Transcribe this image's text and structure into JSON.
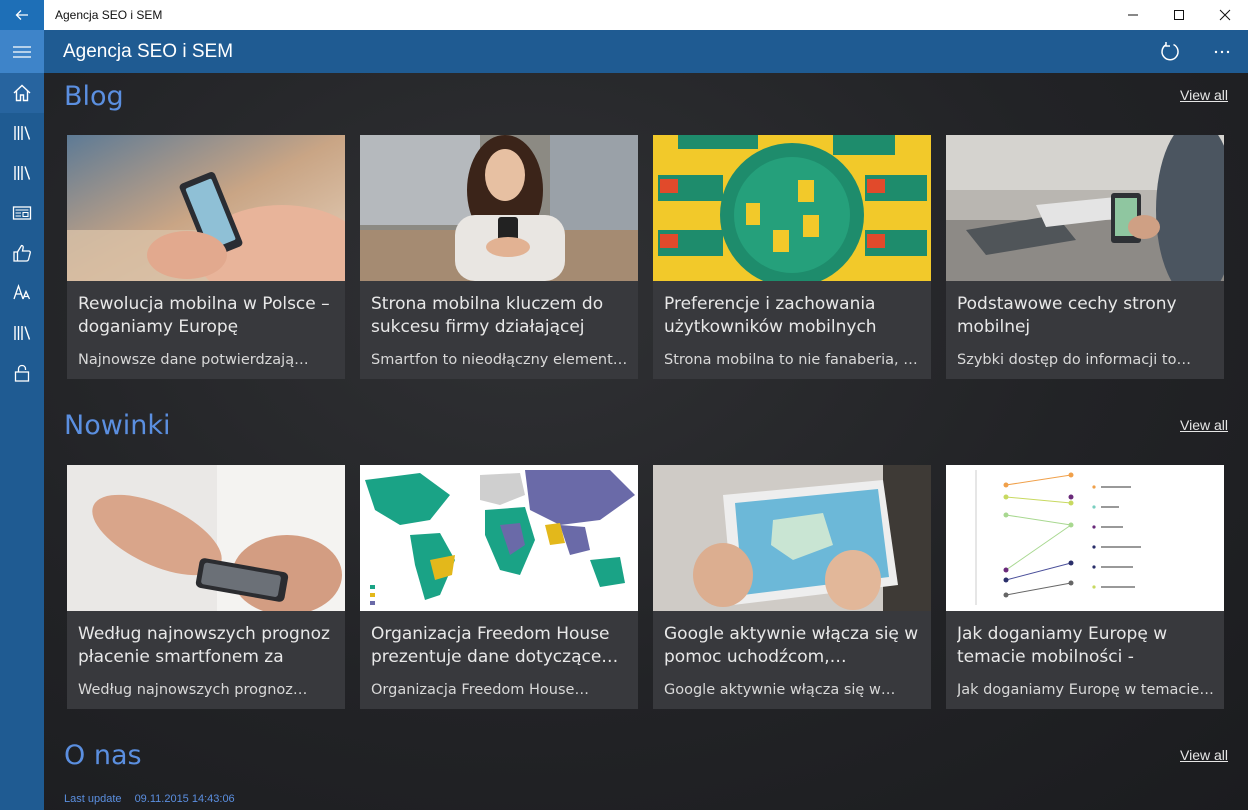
{
  "window": {
    "title": "Agencja SEO i SEM"
  },
  "app": {
    "title": "Agencja SEO i SEM"
  },
  "sections": {
    "blog": {
      "title": "Blog",
      "view_all": "View all",
      "cards": [
        {
          "title": "Rewolucja mobilna w Polsce – doganiamy Europę",
          "subtitle": "Najnowsze dane potwierdzają…"
        },
        {
          "title": "Strona mobilna kluczem do sukcesu firmy działającej lokalnie",
          "subtitle": "Smartfon to nieodłączny element…"
        },
        {
          "title": "Preferencje i zachowania użytkowników mobilnych",
          "subtitle": "Strona mobilna to nie fanaberia, to…"
        },
        {
          "title": "Podstawowe cechy strony mobilnej",
          "subtitle": "Szybki dostęp do informacji to…"
        }
      ]
    },
    "news": {
      "title": "Nowinki",
      "view_all": "View all",
      "cards": [
        {
          "title": "Według najnowszych prognoz płacenie smartfonem za parę…",
          "subtitle": "Według najnowszych prognoz…"
        },
        {
          "title": "Organizacja Freedom House prezentuje dane dotyczące…",
          "subtitle": "Organizacja Freedom House…"
        },
        {
          "title": "Google aktywnie włącza się w pomoc uchodźcom,…",
          "subtitle": "Google aktywnie włącza się w…"
        },
        {
          "title": "Jak doganiamy Europę w temacie mobilności - przeczytaj więcej…",
          "subtitle": "Jak doganiamy Europę w temacie…"
        }
      ]
    },
    "about": {
      "title": "O nas",
      "view_all": "View all"
    }
  },
  "footer": {
    "last_update_label": "Last update",
    "last_update_value": "09.11.2015 14:43:06"
  },
  "rail": {
    "icons": [
      "hamburger-icon",
      "home-icon",
      "library-icon",
      "library-icon",
      "news-icon",
      "thumbs-up-icon",
      "font-icon",
      "library-icon",
      "lock-icon"
    ]
  },
  "colors": {
    "accent": "#1f5b92",
    "section_title": "#5b8fe0"
  }
}
